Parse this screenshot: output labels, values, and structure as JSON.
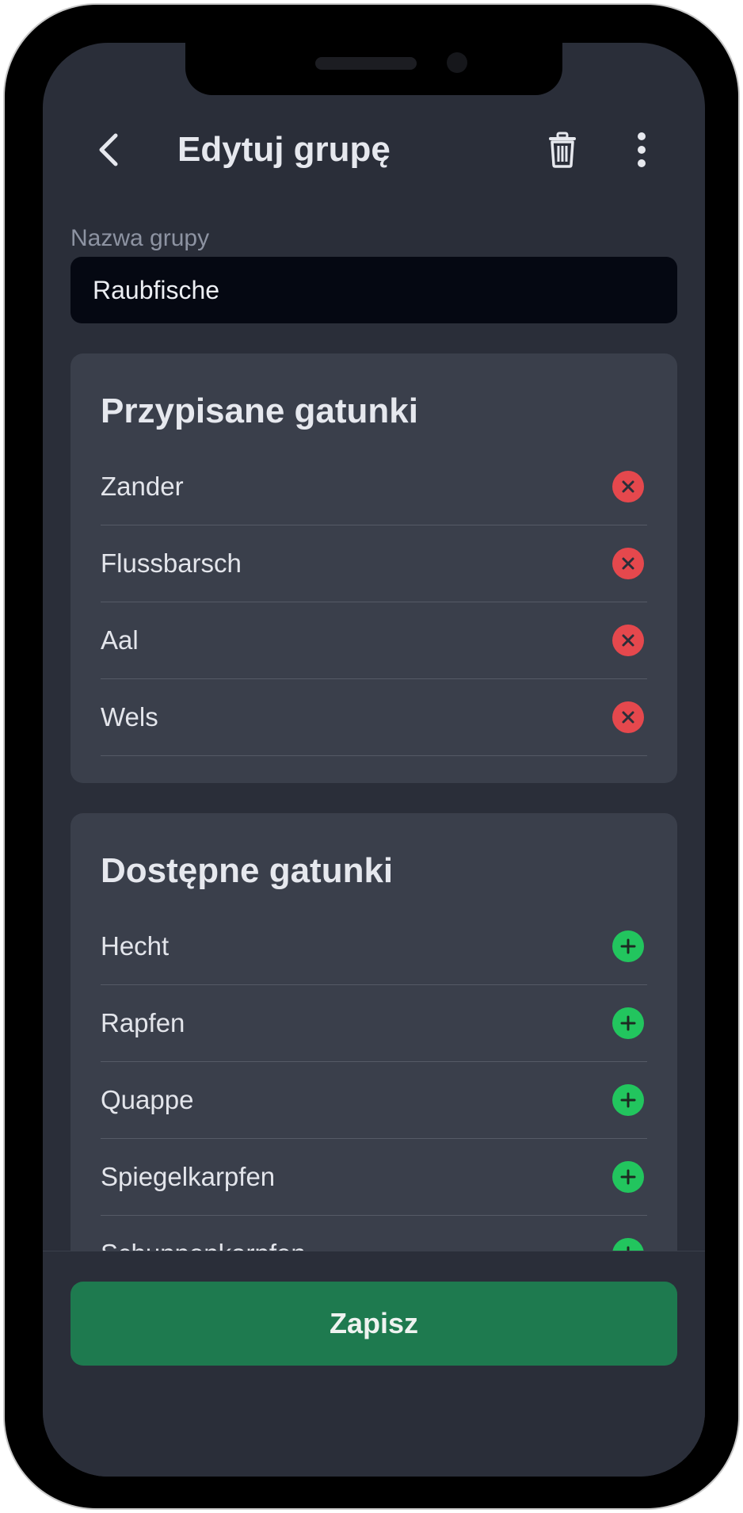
{
  "header": {
    "title": "Edytuj grupę",
    "back_icon": "chevron-left-icon",
    "delete_icon": "trash-icon",
    "more_icon": "more-vertical-icon"
  },
  "group_name": {
    "label": "Nazwa grupy",
    "value": "Raubfische"
  },
  "assigned": {
    "title": "Przypisane gatunki",
    "items": [
      {
        "label": "Zander"
      },
      {
        "label": "Flussbarsch"
      },
      {
        "label": "Aal"
      },
      {
        "label": "Wels"
      }
    ]
  },
  "available": {
    "title": "Dostępne gatunki",
    "items": [
      {
        "label": "Hecht"
      },
      {
        "label": "Rapfen"
      },
      {
        "label": "Quappe"
      },
      {
        "label": "Spiegelkarpfen"
      },
      {
        "label": "Schuppenkarpfen"
      }
    ]
  },
  "save_label": "Zapisz",
  "colors": {
    "background": "#2a2e39",
    "card": "#3a3f4b",
    "input": "#050812",
    "remove": "#e5484d",
    "add": "#22c55e",
    "save": "#1e7a4f"
  }
}
